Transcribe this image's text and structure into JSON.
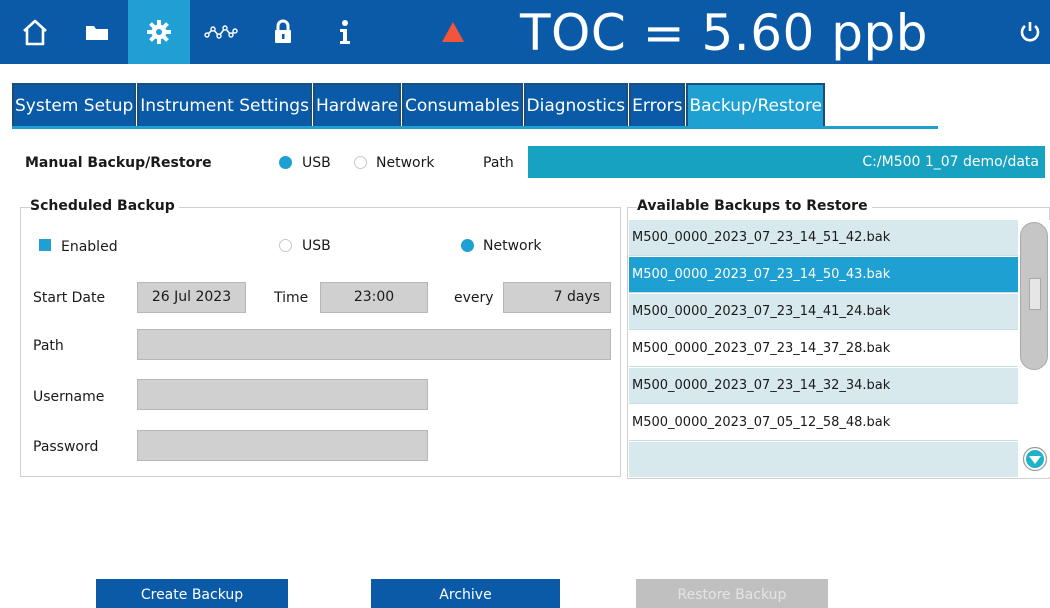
{
  "header": {
    "nav": [
      {
        "icon": "home-icon"
      },
      {
        "icon": "folder-icon"
      },
      {
        "icon": "gear-icon",
        "active": true
      },
      {
        "icon": "trend-graph-icon"
      },
      {
        "icon": "lock-icon"
      },
      {
        "icon": "info-icon"
      },
      {
        "icon": "alarm-triangle-icon"
      }
    ],
    "toc_readout": "TOC = 5.60 ppb",
    "power_icon": "power-icon",
    "colors": {
      "bar": "#0a5aa8",
      "active": "#1f9fd3",
      "alarm": "#f2553a"
    }
  },
  "tabs": [
    {
      "label": "System Setup",
      "active": false
    },
    {
      "label": "Instrument Settings",
      "active": false
    },
    {
      "label": "Hardware",
      "active": false
    },
    {
      "label": "Consumables",
      "active": false
    },
    {
      "label": "Diagnostics",
      "active": false
    },
    {
      "label": "Errors",
      "active": false
    },
    {
      "label": "Backup/Restore",
      "active": true
    }
  ],
  "manual": {
    "title": "Manual Backup/Restore",
    "usb_label": "USB",
    "usb_selected": true,
    "network_label": "Network",
    "network_selected": false,
    "path_label": "Path",
    "path_value": "C:/M500 1_07 demo/data"
  },
  "scheduled": {
    "title": "Scheduled Backup",
    "enabled_label": "Enabled",
    "enabled_checked": true,
    "usb_label": "USB",
    "usb_selected": false,
    "network_label": "Network",
    "network_selected": true,
    "start_date_label": "Start Date",
    "start_date_value": "26 Jul 2023",
    "time_label": "Time",
    "time_value": "23:00",
    "every_label": "every",
    "every_value": "7 days",
    "path_label": "Path",
    "path_value": "",
    "username_label": "Username",
    "username_value": "",
    "password_label": "Password",
    "password_value": ""
  },
  "available": {
    "title": "Available Backups to Restore",
    "items": [
      {
        "name": "M500_0000_2023_07_23_14_51_42.bak",
        "selected": false
      },
      {
        "name": "M500_0000_2023_07_23_14_50_43.bak",
        "selected": true
      },
      {
        "name": "M500_0000_2023_07_23_14_41_24.bak",
        "selected": false
      },
      {
        "name": "M500_0000_2023_07_23_14_37_28.bak",
        "selected": false
      },
      {
        "name": "M500_0000_2023_07_23_14_32_34.bak",
        "selected": false
      },
      {
        "name": "M500_0000_2023_07_05_12_58_48.bak",
        "selected": false
      }
    ],
    "scroll_down_icon": "scroll-down-arrow-icon"
  },
  "buttons": {
    "create_backup": "Create Backup",
    "archive": "Archive",
    "restore_backup": "Restore Backup",
    "restore_enabled": false
  }
}
